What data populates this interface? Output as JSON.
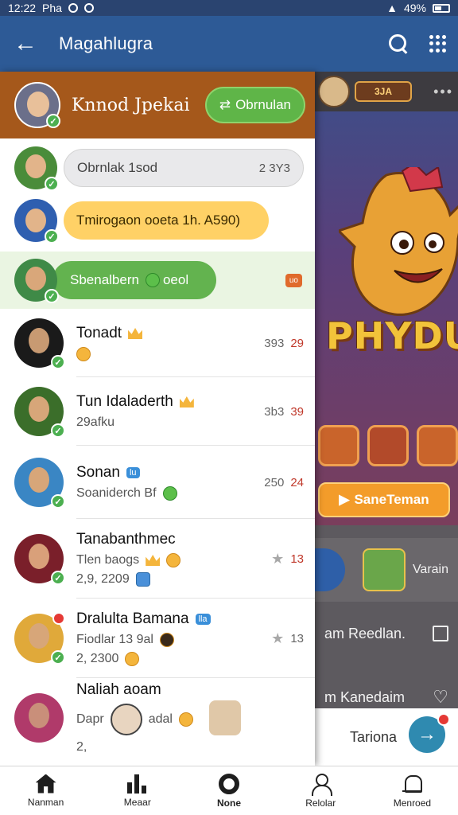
{
  "status_bar": {
    "time": "12:22",
    "carrier": "Pha",
    "battery": "49%"
  },
  "app_bar": {
    "title": "Magahlugra"
  },
  "drawer": {
    "header": {
      "name": "Knnod Jpekai",
      "button_label": "Obrnulan"
    },
    "pill_rows": [
      {
        "text": "Obrnlak 1sod",
        "trail": "2 3Y3",
        "style": "gray"
      },
      {
        "text": "Tmirogaon ooeta  1h. A590)",
        "trail": "",
        "style": "yellow"
      },
      {
        "text": "Sbenalbern",
        "trail": "oeol",
        "style": "green",
        "tag": "uo"
      }
    ],
    "contacts": [
      {
        "name": "Tonadt",
        "sub": "",
        "meta": "393",
        "num": "29"
      },
      {
        "name": "Tun Idaladerth",
        "sub": "29afku",
        "meta": "3b3",
        "num": "39"
      },
      {
        "name": "Sonan",
        "name_badge": "lu",
        "sub": "Soaniderch Bf",
        "meta": "250",
        "num": "24"
      },
      {
        "name": "Tanabanthmec",
        "sub": "Tlen baogs",
        "sub2": "2,9, 2209",
        "meta": "",
        "num": "13"
      },
      {
        "name": "Dralulta Bamana",
        "name_badge": "lla",
        "sub": "Fiodlar 13 9al",
        "sub2": "2, 2300",
        "meta": "",
        "num": "13"
      },
      {
        "name": "Naliah aoam",
        "sub": "Dapr",
        "sub_trail": "adal",
        "sub2": "2,",
        "meta": "",
        "num": ""
      }
    ]
  },
  "game_panel": {
    "badge": "3JA",
    "logo": "PHYDU",
    "button_label": "SaneTeman"
  },
  "right_rows": [
    {
      "label": "Varain"
    },
    {
      "label": "am Reedlan."
    },
    {
      "label": "m Kanedaim"
    },
    {
      "label": "Tariona"
    }
  ],
  "bottom_nav": [
    {
      "label": "Nanman",
      "icon": "home-icon"
    },
    {
      "label": "Meaar",
      "icon": "bars-icon"
    },
    {
      "label": "None",
      "icon": "ring-icon"
    },
    {
      "label": "Relolar",
      "icon": "user-icon"
    },
    {
      "label": "Menroed",
      "icon": "bell-icon"
    }
  ],
  "colors": {
    "app_bar": "#2d5a96",
    "drawer_header": "#a5581b",
    "follow_button": "#5fb548",
    "highlight_row": "#eaf5e2",
    "yellow_pill": "#ffd166",
    "game_button": "#f39c2a"
  }
}
